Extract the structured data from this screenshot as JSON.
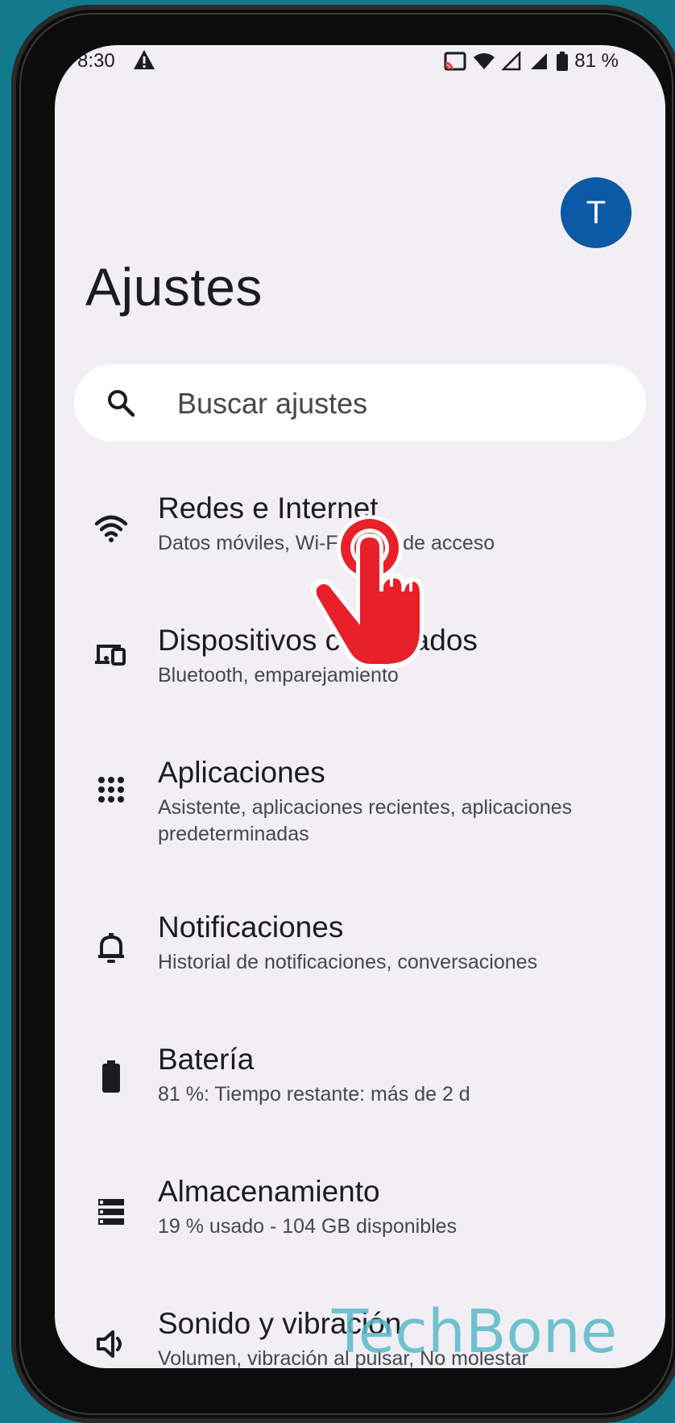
{
  "status_bar": {
    "time": "8:30",
    "battery": "81 %"
  },
  "header": {
    "title": "Ajustes",
    "avatar_initial": "T"
  },
  "search": {
    "placeholder": "Buscar ajustes"
  },
  "items": [
    {
      "title": "Redes e Internet",
      "subtitle": "Datos móviles, Wi-Fi, zona de acceso",
      "icon": "wifi-icon"
    },
    {
      "title": "Dispositivos conectados",
      "subtitle": "Bluetooth, emparejamiento",
      "icon": "devices-icon"
    },
    {
      "title": "Aplicaciones",
      "subtitle": "Asistente, aplicaciones recientes, aplicaciones predeterminadas",
      "icon": "apps-grid-icon"
    },
    {
      "title": "Notificaciones",
      "subtitle": "Historial de notificaciones, conversaciones",
      "icon": "bell-icon"
    },
    {
      "title": "Batería",
      "subtitle": "81 %: Tiempo restante: más de 2 d",
      "icon": "battery-icon"
    },
    {
      "title": "Almacenamiento",
      "subtitle": "19 % usado - 104 GB disponibles",
      "icon": "storage-icon"
    },
    {
      "title": "Sonido y vibración",
      "subtitle": "Volumen, vibración al pulsar, No molestar",
      "icon": "speaker-icon"
    }
  ],
  "watermark": "TechBone",
  "colors": {
    "background": "#137a8e",
    "screen": "#f1eff4",
    "avatar": "#0c5aa6",
    "hand": "#e8202a"
  }
}
